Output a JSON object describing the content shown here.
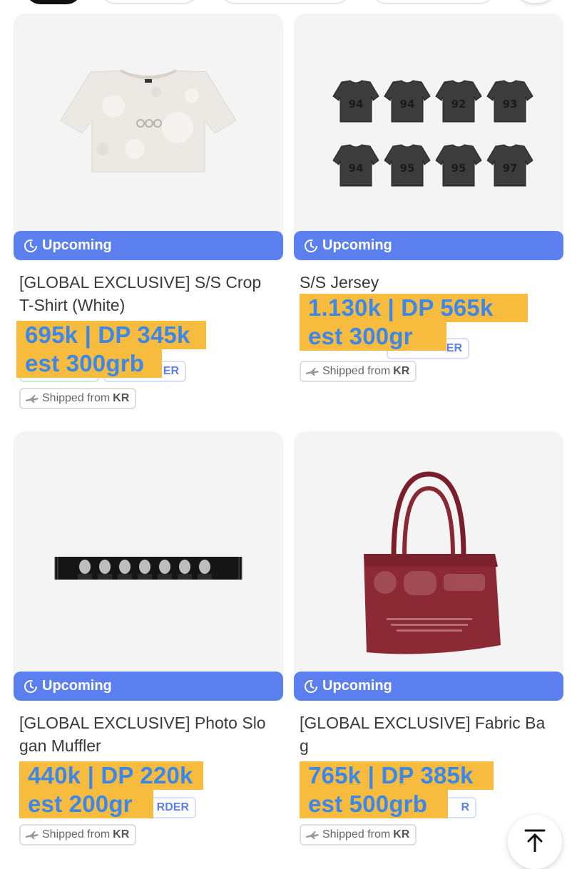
{
  "products": [
    {
      "status": "Upcoming",
      "title_lines": [
        "[GLOBAL EXCLUSIVE] S/S Crop",
        "T-Shirt (White)"
      ],
      "price_line1": "695k | DP 345k",
      "price_line2": "est 300grb",
      "tag_fragment": "ER",
      "ship_prefix": "Shipped from",
      "ship_origin": "KR"
    },
    {
      "status": "Upcoming",
      "title_lines": [
        "S/S Jersey"
      ],
      "price_line1": "1.130k | DP 565k",
      "price_line2": "est 300gr",
      "tag_fragment": "ER",
      "ship_prefix": "Shipped from",
      "ship_origin": "KR",
      "jersey_numbers": [
        "94",
        "94",
        "92",
        "93",
        "94",
        "95",
        "95",
        "97"
      ]
    },
    {
      "status": "Upcoming",
      "title_lines": [
        "[GLOBAL EXCLUSIVE] Photo Slo",
        "gan Muffler"
      ],
      "price_line1": "440k | DP 220k",
      "price_line2": "est 200gr",
      "tag_fragment": "RDER",
      "ship_prefix": "Shipped from",
      "ship_origin": "KR"
    },
    {
      "status": "Upcoming",
      "title_lines": [
        "[GLOBAL EXCLUSIVE] Fabric Ba",
        "g"
      ],
      "price_line1": "765k | DP 385k",
      "price_line2": "est 500grb",
      "tag_fragment": "R",
      "ship_prefix": "Shipped from",
      "ship_origin": "KR"
    }
  ],
  "colors": {
    "status_bg": "#5b7fee",
    "highlight_bg": "#f7bb3e",
    "highlight_text": "#3d87e8",
    "thumb_bg": "#f4f4f4"
  },
  "icons": {
    "status": "clock-icon",
    "shipping": "airplane-icon",
    "scroll_top": "arrow-up-to-line-icon"
  }
}
